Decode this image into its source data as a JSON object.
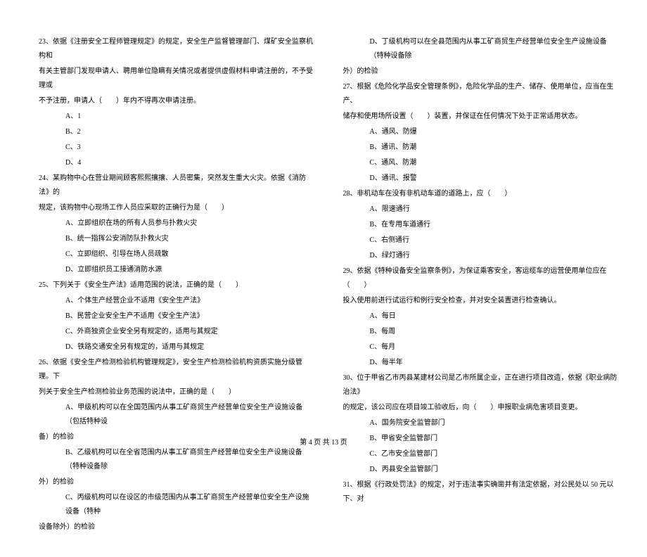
{
  "left_column": {
    "q23": {
      "line1": "23、依据《注册安全工程师管理规定》的规定，安全生产监督管理部门、煤矿安全监察机构和",
      "line2": "有关主管部门发现申请人、聘用单位隐瞒有关情况或者提供虚假材料申请注册的，不予受理或",
      "line3": "不予注册，申请人（　　）年内不得再次申请注册。",
      "optA": "A、1",
      "optB": "B、2",
      "optC": "C、3",
      "optD": "D、4"
    },
    "q24": {
      "line1": "24、某购物中心在营业期间顾客熙熙攘攘、人员密集，突然发生重大火灾。依据《消防法》的",
      "line2": "规定，该购物中心现场工作人员应采取的正确行为是（　　）",
      "optA": "A、立即组织在场的所有人员参与扑救火灾",
      "optB": "B、统一指挥公安消防队扑救火灾",
      "optC": "C、立即组织、引导在场人员疏散",
      "optD": "D、立即组织员工接通消防水源"
    },
    "q25": {
      "line1": "25、下列关于《安全生产法》适用范围的说法，正确的是（　　）",
      "optA": "A、个体生产经营企业不适用《安全生产法》",
      "optB": "B、民营企业安全生产不适用《安全生产法》",
      "optC": "C、外商独资企业安全另有规定的，适用与其规定",
      "optD": "D、铁路交通安全另有规定的，适用与其规定"
    },
    "q26": {
      "line1": "26、依据《安全生产检测检验机构管理规定》，安全生产检测检验机构资质实施分级管理。下",
      "line2": "列关于安全生产检测检验业务范围的说法中，正确的是（　　）",
      "optA": "A、甲级机构可以在全国范围内从事工矿商贸生产经营单位安全生产设施设备（包括特种设",
      "optA2": "备）的检验",
      "optB": "B、乙级机构可以在全省范围内从事工矿商贸生产经营单位安全生产设施设备（特种设备除",
      "optB2": "外）的检验",
      "optC": "C、丙级机构可以在设区的市级范围内从事工矿商贸生产经营单位安全生产设施设备（特种",
      "optC2": "设备除外）的检验"
    }
  },
  "right_column": {
    "q26d": {
      "optD": "D、丁级机构可以在全县范围内从事工矿商贸生产经营单位安全生产设施设备（特种设备除",
      "optD2": "外）的检验"
    },
    "q27": {
      "line1": "27、根据《危险化学品安全管理条例》，危险化学品的生产、储存、使用单位，应当在生产、",
      "line2": "储存和使用场所设置（　　）装置，并保证在任何情况下处于正常适用状态。",
      "optA": "A、通风、防爆",
      "optB": "B、通讯、防潮",
      "optC": "C、通风、防潮",
      "optD": "D、通讯、报警"
    },
    "q28": {
      "line1": "28、非机动车在没有非机动车道的道路上，应（　　）",
      "optA": "A、限速通行",
      "optB": "B、在专用车道通行",
      "optC": "C、右侧通行",
      "optD": "D、绿灯通行"
    },
    "q29": {
      "line1": "29、依据《特种设备安全监察条例》，为保证乘客安全，客运缆车的运营使用单位应在（　　）",
      "line2": "投入使用前进行试运行和例行安全检查，并对安全装置进行检查确认。",
      "optA": "A、每日",
      "optB": "B、每周",
      "optC": "C、每月",
      "optD": "D、每半年"
    },
    "q30": {
      "line1": "30、位于甲省乙市丙县某建材公司是乙市所属企业，正在进行项目改造，依据《职业病防治法》",
      "line2": "的规定，该公司应在项目竣工验收后，向（　　）申报职业病危害项目变更。",
      "optA": "A、国务院安全监管部门",
      "optB": "B、甲省安全监管部门",
      "optC": "C、乙市安全监管部门",
      "optD": "D、丙县安全监管部门"
    },
    "q31": {
      "line1": "31、根据《行政处罚法》的规定，对于违法事实确凿并有法定依据，对公民处以 50 元以下、对"
    }
  },
  "footer": "第 4 页 共 13 页"
}
